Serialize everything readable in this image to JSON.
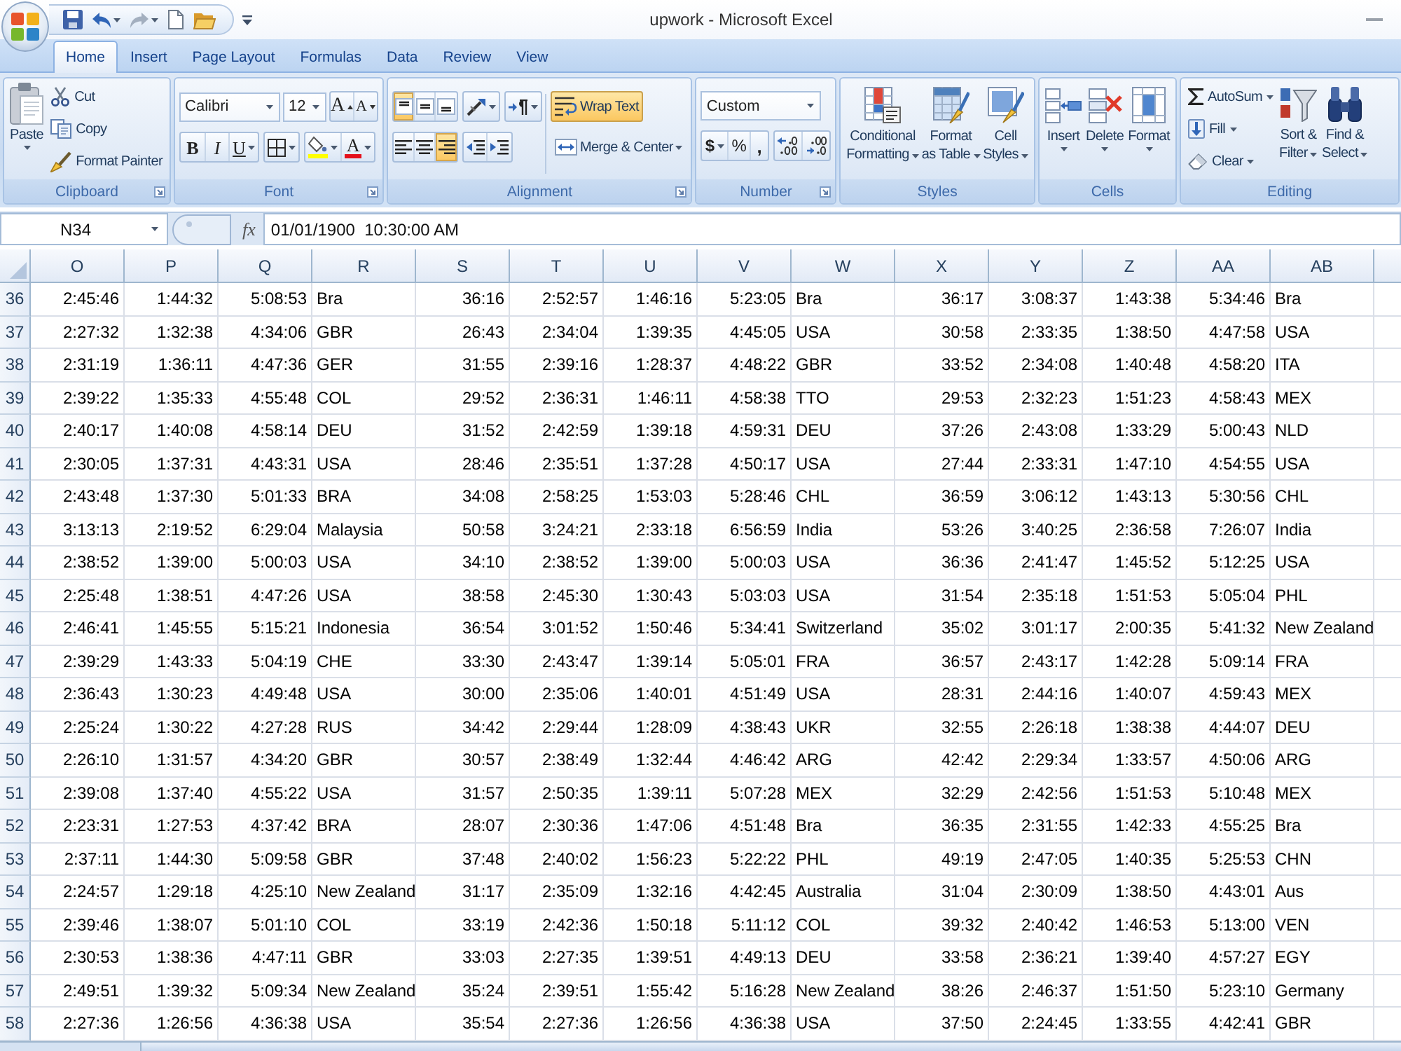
{
  "window": {
    "title": "upwork - Microsoft Excel"
  },
  "tabs": [
    {
      "label": "Home",
      "selected": true
    },
    {
      "label": "Insert",
      "selected": false
    },
    {
      "label": "Page Layout",
      "selected": false
    },
    {
      "label": "Formulas",
      "selected": false
    },
    {
      "label": "Data",
      "selected": false
    },
    {
      "label": "Review",
      "selected": false
    },
    {
      "label": "View",
      "selected": false
    }
  ],
  "ribbon": {
    "clipboard": {
      "label": "Clipboard",
      "paste": "Paste",
      "actions": [
        {
          "kind": "cut",
          "label": "Cut"
        },
        {
          "kind": "copy",
          "label": "Copy"
        },
        {
          "kind": "painter",
          "label": "Format Painter"
        }
      ]
    },
    "font": {
      "label": "Font",
      "name": "Calibri",
      "size": "12",
      "grow": "A",
      "shrink": "A",
      "bold": "B",
      "italic": "I",
      "underline": "U",
      "font_color": "A"
    },
    "alignment": {
      "label": "Alignment",
      "vertical": [
        {
          "kind": "top",
          "selected": true
        },
        {
          "kind": "middle",
          "selected": false
        },
        {
          "kind": "bottom",
          "selected": false
        }
      ],
      "horizontal": [
        {
          "kind": "left",
          "selected": false
        },
        {
          "kind": "center",
          "selected": false
        },
        {
          "kind": "right",
          "selected": true
        }
      ],
      "wrap_text": {
        "label": "Wrap Text",
        "selected": true
      },
      "merge": "Merge & Center"
    },
    "number": {
      "label": "Number",
      "format": "Custom",
      "currency": "$",
      "percent": "%",
      "comma": ","
    },
    "styles": {
      "label": "Styles",
      "buttons": [
        {
          "kind": "conditional",
          "lines": [
            "Conditional",
            "Formatting"
          ]
        },
        {
          "kind": "table",
          "lines": [
            "Format",
            "as Table"
          ]
        },
        {
          "kind": "cell_styles",
          "lines": [
            "Cell",
            "Styles"
          ]
        }
      ]
    },
    "cells": {
      "label": "Cells",
      "buttons": [
        {
          "kind": "insert",
          "label": "Insert"
        },
        {
          "kind": "delete",
          "label": "Delete"
        },
        {
          "kind": "format",
          "label": "Format"
        }
      ]
    },
    "editing": {
      "label": "Editing",
      "actions": [
        {
          "kind": "autosum",
          "label": "AutoSum"
        },
        {
          "kind": "fill",
          "label": "Fill"
        },
        {
          "kind": "clear",
          "label": "Clear"
        }
      ],
      "buttons": [
        {
          "kind": "sort",
          "lines": [
            "Sort &",
            "Filter"
          ]
        },
        {
          "kind": "find",
          "lines": [
            "Find &",
            "Select"
          ]
        }
      ]
    }
  },
  "formula_bar": {
    "name_box": "N34",
    "function_button": "fx",
    "formula": "01/01/1900  10:30:00 AM"
  },
  "sheet": {
    "columns": [
      {
        "label": "O",
        "kind": "time"
      },
      {
        "label": "P",
        "kind": "time"
      },
      {
        "label": "Q",
        "kind": "time"
      },
      {
        "label": "R",
        "kind": "text"
      },
      {
        "label": "S",
        "kind": "time"
      },
      {
        "label": "T",
        "kind": "time"
      },
      {
        "label": "U",
        "kind": "time"
      },
      {
        "label": "V",
        "kind": "time"
      },
      {
        "label": "W",
        "kind": "text"
      },
      {
        "label": "X",
        "kind": "time"
      },
      {
        "label": "Y",
        "kind": "time"
      },
      {
        "label": "Z",
        "kind": "time"
      },
      {
        "label": "AA",
        "kind": "time"
      },
      {
        "label": "AB",
        "kind": "text"
      }
    ],
    "rows": [
      {
        "header": "36",
        "cells": [
          "2:45:46",
          "1:44:32",
          "5:08:53",
          "Bra",
          "36:16",
          "2:52:57",
          "1:46:16",
          "5:23:05",
          "Bra",
          "36:17",
          "3:08:37",
          "1:43:38",
          "5:34:46",
          "Bra"
        ]
      },
      {
        "header": "37",
        "cells": [
          "2:27:32",
          "1:32:38",
          "4:34:06",
          "GBR",
          "26:43",
          "2:34:04",
          "1:39:35",
          "4:45:05",
          "USA",
          "30:58",
          "2:33:35",
          "1:38:50",
          "4:47:58",
          "USA"
        ]
      },
      {
        "header": "38",
        "cells": [
          "2:31:19",
          "1:36:11",
          "4:47:36",
          "GER",
          "31:55",
          "2:39:16",
          "1:28:37",
          "4:48:22",
          "GBR",
          "33:52",
          "2:34:08",
          "1:40:48",
          "4:58:20",
          "ITA"
        ]
      },
      {
        "header": "39",
        "cells": [
          "2:39:22",
          "1:35:33",
          "4:55:48",
          "COL",
          "29:52",
          "2:36:31",
          "1:46:11",
          "4:58:38",
          "TTO",
          "29:53",
          "2:32:23",
          "1:51:23",
          "4:58:43",
          "MEX"
        ]
      },
      {
        "header": "40",
        "cells": [
          "2:40:17",
          "1:40:08",
          "4:58:14",
          "DEU",
          "31:52",
          "2:42:59",
          "1:39:18",
          "4:59:31",
          "DEU",
          "37:26",
          "2:43:08",
          "1:33:29",
          "5:00:43",
          "NLD"
        ]
      },
      {
        "header": "41",
        "cells": [
          "2:30:05",
          "1:37:31",
          "4:43:31",
          "USA",
          "28:46",
          "2:35:51",
          "1:37:28",
          "4:50:17",
          "USA",
          "27:44",
          "2:33:31",
          "1:47:10",
          "4:54:55",
          "USA"
        ]
      },
      {
        "header": "42",
        "cells": [
          "2:43:48",
          "1:37:30",
          "5:01:33",
          "BRA",
          "34:08",
          "2:58:25",
          "1:53:03",
          "5:28:46",
          "CHL",
          "36:59",
          "3:06:12",
          "1:43:13",
          "5:30:56",
          "CHL"
        ]
      },
      {
        "header": "43",
        "cells": [
          "3:13:13",
          "2:19:52",
          "6:29:04",
          "Malaysia",
          "50:58",
          "3:24:21",
          "2:33:18",
          "6:56:59",
          "India",
          "53:26",
          "3:40:25",
          "2:36:58",
          "7:26:07",
          "India"
        ]
      },
      {
        "header": "44",
        "cells": [
          "2:38:52",
          "1:39:00",
          "5:00:03",
          "USA",
          "34:10",
          "2:38:52",
          "1:39:00",
          "5:00:03",
          "USA",
          "36:36",
          "2:41:47",
          "1:45:52",
          "5:12:25",
          "USA"
        ]
      },
      {
        "header": "45",
        "cells": [
          "2:25:48",
          "1:38:51",
          "4:47:26",
          "USA",
          "38:58",
          "2:45:30",
          "1:30:43",
          "5:03:03",
          "USA",
          "31:54",
          "2:35:18",
          "1:51:53",
          "5:05:04",
          "PHL"
        ]
      },
      {
        "header": "46",
        "cells": [
          "2:46:41",
          "1:45:55",
          "5:15:21",
          "Indonesia",
          "36:54",
          "3:01:52",
          "1:50:46",
          "5:34:41",
          "Switzerland",
          "35:02",
          "3:01:17",
          "2:00:35",
          "5:41:32",
          "New Zealand"
        ]
      },
      {
        "header": "47",
        "cells": [
          "2:39:29",
          "1:43:33",
          "5:04:19",
          "CHE",
          "33:30",
          "2:43:47",
          "1:39:14",
          "5:05:01",
          "FRA",
          "36:57",
          "2:43:17",
          "1:42:28",
          "5:09:14",
          "FRA"
        ]
      },
      {
        "header": "48",
        "cells": [
          "2:36:43",
          "1:30:23",
          "4:49:48",
          "USA",
          "30:00",
          "2:35:06",
          "1:40:01",
          "4:51:49",
          "USA",
          "28:31",
          "2:44:16",
          "1:40:07",
          "4:59:43",
          "MEX"
        ]
      },
      {
        "header": "49",
        "cells": [
          "2:25:24",
          "1:30:22",
          "4:27:28",
          "RUS",
          "34:42",
          "2:29:44",
          "1:28:09",
          "4:38:43",
          "UKR",
          "32:55",
          "2:26:18",
          "1:38:38",
          "4:44:07",
          "DEU"
        ]
      },
      {
        "header": "50",
        "cells": [
          "2:26:10",
          "1:31:57",
          "4:34:20",
          "GBR",
          "30:57",
          "2:38:49",
          "1:32:44",
          "4:46:42",
          "ARG",
          "42:42",
          "2:29:34",
          "1:33:57",
          "4:50:06",
          "ARG"
        ]
      },
      {
        "header": "51",
        "cells": [
          "2:39:08",
          "1:37:40",
          "4:55:22",
          "USA",
          "31:57",
          "2:50:35",
          "1:39:11",
          "5:07:28",
          "MEX",
          "32:29",
          "2:42:56",
          "1:51:53",
          "5:10:48",
          "MEX"
        ]
      },
      {
        "header": "52",
        "cells": [
          "2:23:31",
          "1:27:53",
          "4:37:42",
          "BRA",
          "28:07",
          "2:30:36",
          "1:47:06",
          "4:51:48",
          "Bra",
          "36:35",
          "2:31:55",
          "1:42:33",
          "4:55:25",
          "Bra"
        ]
      },
      {
        "header": "53",
        "cells": [
          "2:37:11",
          "1:44:30",
          "5:09:58",
          "GBR",
          "37:48",
          "2:40:02",
          "1:56:23",
          "5:22:22",
          "PHL",
          "49:19",
          "2:47:05",
          "1:40:35",
          "5:25:53",
          "CHN"
        ]
      },
      {
        "header": "54",
        "cells": [
          "2:24:57",
          "1:29:18",
          "4:25:10",
          "New Zealand",
          "31:17",
          "2:35:09",
          "1:32:16",
          "4:42:45",
          "Australia",
          "31:04",
          "2:30:09",
          "1:38:50",
          "4:43:01",
          "Aus"
        ]
      },
      {
        "header": "55",
        "cells": [
          "2:39:46",
          "1:38:07",
          "5:01:10",
          "COL",
          "33:19",
          "2:42:36",
          "1:50:18",
          "5:11:12",
          "COL",
          "39:32",
          "2:40:42",
          "1:46:53",
          "5:13:00",
          "VEN"
        ]
      },
      {
        "header": "56",
        "cells": [
          "2:30:53",
          "1:38:36",
          "4:47:11",
          "GBR",
          "33:03",
          "2:27:35",
          "1:39:51",
          "4:49:13",
          "DEU",
          "33:58",
          "2:36:21",
          "1:39:40",
          "4:57:27",
          "EGY"
        ]
      },
      {
        "header": "57",
        "cells": [
          "2:49:51",
          "1:39:32",
          "5:09:34",
          "New Zealand",
          "35:24",
          "2:39:51",
          "1:55:42",
          "5:16:28",
          "New Zealand",
          "38:26",
          "2:46:37",
          "1:51:50",
          "5:23:10",
          "Germany"
        ]
      },
      {
        "header": "58",
        "cells": [
          "2:27:36",
          "1:26:56",
          "4:36:38",
          "USA",
          "35:54",
          "2:27:36",
          "1:26:56",
          "4:36:38",
          "USA",
          "37:50",
          "2:24:45",
          "1:33:55",
          "4:42:41",
          "GBR"
        ]
      }
    ]
  }
}
